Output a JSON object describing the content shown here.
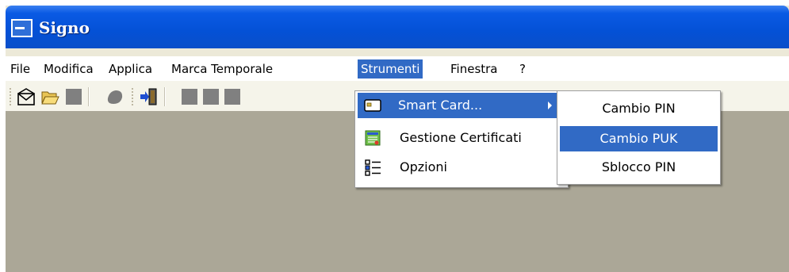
{
  "window": {
    "title": "Signo",
    "icon": "app-icon"
  },
  "menubar": {
    "items": [
      {
        "label": "File"
      },
      {
        "label": "Modifica"
      },
      {
        "label": "Applica"
      },
      {
        "label": "Marca Temporale"
      },
      {
        "label": "Strumenti",
        "active": true
      },
      {
        "label": "Finestra"
      },
      {
        "label": "?"
      }
    ]
  },
  "toolbar": {
    "icons": [
      "envelope-icon",
      "open-folder-icon",
      "gray-square-icon",
      "stamp-icon",
      "import-icon",
      "gray-square-icon",
      "gray-square-icon",
      "gray-square-icon"
    ]
  },
  "dropdown": {
    "items": [
      {
        "label": "Smart Card...",
        "icon": "smart-card-icon",
        "has_submenu": true,
        "active": true
      },
      {
        "label": "Gestione Certificati",
        "icon": "certificate-icon"
      },
      {
        "label": "Opzioni",
        "icon": "options-list-icon"
      }
    ]
  },
  "submenu": {
    "items": [
      {
        "label": "Cambio PIN"
      },
      {
        "label": "Cambio PUK",
        "active": true
      },
      {
        "label": "Sblocco PIN"
      }
    ]
  },
  "colors": {
    "titlebar": "#0451d6",
    "highlight": "#316ac5",
    "workspace": "#aba797",
    "toolbar": "#f5f4ea"
  }
}
